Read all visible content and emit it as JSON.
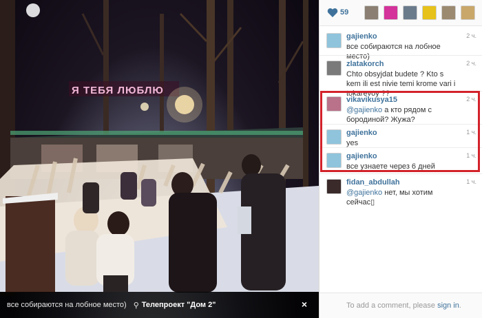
{
  "photo": {
    "caption": "все собираются на лобное место)",
    "location": "Телепроект \"Дом 2\"",
    "close_label": "×",
    "sign_text": "Я ТЕБЯ ЛЮБЛЮ"
  },
  "likes": {
    "count": "59",
    "likers": [
      {
        "icon": "liker-avatar-1",
        "color": "#8a7f72"
      },
      {
        "icon": "liker-avatar-2",
        "color": "#d3339a"
      },
      {
        "icon": "liker-avatar-3",
        "color": "#6a7b8c"
      },
      {
        "icon": "liker-avatar-4",
        "color": "#e6c21a"
      },
      {
        "icon": "liker-avatar-5",
        "color": "#9b8a70"
      },
      {
        "icon": "liker-avatar-6",
        "color": "#c9a76b"
      }
    ]
  },
  "comments": [
    {
      "user": "gajienko",
      "time": "2 ч.",
      "mention": "",
      "text": "все собираются на лобное место)",
      "avatar_color": "#8fc4dc"
    },
    {
      "user": "zlatakorch",
      "time": "2 ч.",
      "mention": "",
      "text": "Chto obsyjdat budete ? Kto s kem ili est nivie temi krome vari i tokarevoy ??",
      "avatar_color": "#7a7a7a"
    },
    {
      "user": "vikavikusya15",
      "time": "2 ч.",
      "mention": "@gajienko",
      "text": " а кто рядом с бородиной? Жужа?",
      "avatar_color": "#b9728a"
    },
    {
      "user": "gajienko",
      "time": "1 ч.",
      "mention": "",
      "text": "yes",
      "avatar_color": "#8fc4dc"
    },
    {
      "user": "gajienko",
      "time": "1 ч.",
      "mention": "",
      "text": "все узнаете через 6 дней",
      "avatar_color": "#8fc4dc"
    },
    {
      "user": "fidan_abdullah",
      "time": "1 ч.",
      "mention": "@gajienko",
      "text": " нет, мы хотим сейчас▯",
      "avatar_color": "#3a2a2a"
    }
  ],
  "add_comment": {
    "prefix": "To add a comment, please ",
    "link": "sign in",
    "suffix": "."
  },
  "colors": {
    "accent": "#3f729b",
    "highlight": "#d3222a"
  }
}
